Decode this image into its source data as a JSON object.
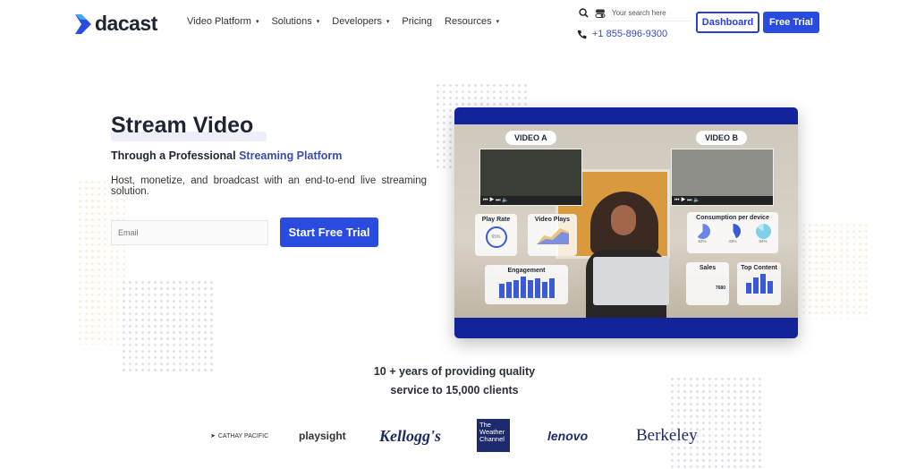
{
  "brand": {
    "name": "dacast",
    "color": "#2a4be0"
  },
  "nav": {
    "items": [
      {
        "label": "Video Platform",
        "dropdown": true
      },
      {
        "label": "Solutions",
        "dropdown": true
      },
      {
        "label": "Developers",
        "dropdown": true
      },
      {
        "label": "Pricing",
        "dropdown": false
      },
      {
        "label": "Resources",
        "dropdown": true
      }
    ],
    "caret": "▾"
  },
  "search": {
    "placeholder": "Your search here",
    "icon": "search-icon"
  },
  "phone": {
    "number": "+1 855-896-9300",
    "icon": "phone-icon"
  },
  "header": {
    "dashboard_label": "Dashboard",
    "free_trial_label": "Free Trial"
  },
  "hero": {
    "title": "Stream Video",
    "subtitle_prefix": "Through a Professional ",
    "subtitle_highlight": "Streaming Platform",
    "description": "Host, monetize, and broadcast with an end-to-end live streaming solution.",
    "email_placeholder": "Email",
    "cta_label": "Start Free Trial"
  },
  "video": {
    "label_a": "VIDEO A",
    "label_b": "VIDEO B",
    "cards": {
      "play_rate": "Play Rate",
      "play_rate_value": "65%",
      "video_plays": "Video Plays",
      "engagement": "Engagement",
      "consumption": "Consumption per device",
      "consumption_values": [
        "62%",
        "43%",
        "84%"
      ],
      "sales": "Sales",
      "sales_value": "7680",
      "top_content": "Top Content"
    }
  },
  "tagline": {
    "line1": "10 + years of providing quality",
    "line2": "service to 15,000 clients"
  },
  "clients": [
    "CATHAY PACIFIC",
    "playsight",
    "Kellogg's",
    "The Weather Channel",
    "lenovo",
    "Berkeley"
  ]
}
